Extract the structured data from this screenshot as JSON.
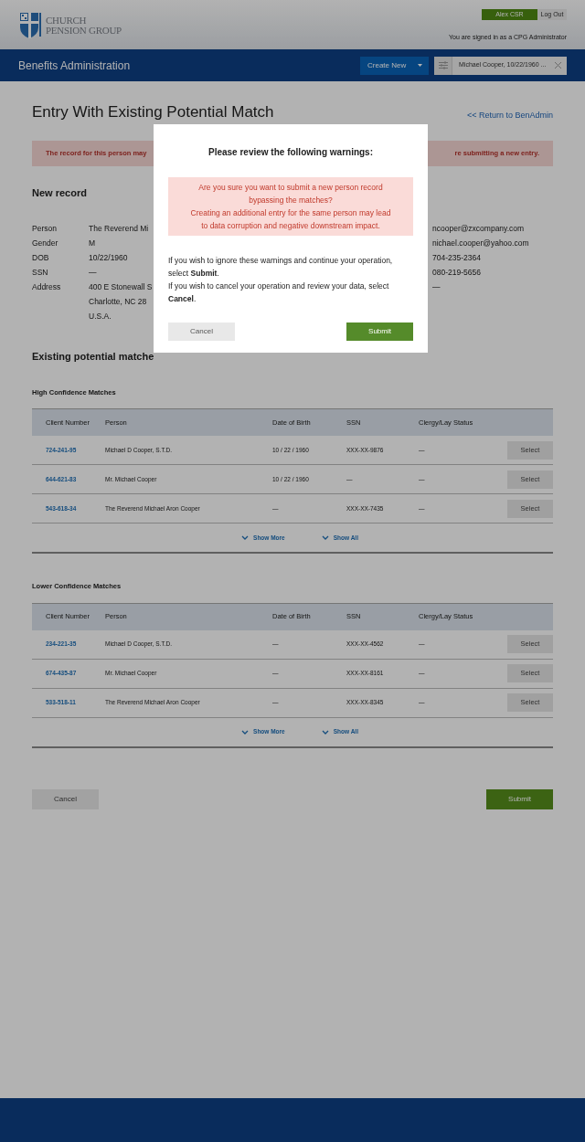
{
  "header": {
    "logo_lines": [
      "CHURCH",
      "PENSION GROUP"
    ],
    "user_button": "Alex CSR",
    "logout_button": "Log Out",
    "signed_in": "You are signed in as a CPG Administrator"
  },
  "navbar": {
    "title": "Benefits Administration",
    "create_new": "Create New",
    "search_chip": "Michael Cooper, 10/22/1960 ..."
  },
  "page": {
    "title": "Entry With Existing Potential Match",
    "return_link": "<< Return to BenAdmin",
    "warning_banner": [
      "The record for this person may",
      "re submitting a new entry."
    ]
  },
  "new_record": {
    "heading": "New record",
    "fields": [
      {
        "label": "Person",
        "values": [
          "The Reverend Mi"
        ]
      },
      {
        "label": "Gender",
        "values": [
          "M"
        ]
      },
      {
        "label": "DOB",
        "values": [
          "10/22/1960"
        ]
      },
      {
        "label": "SSN",
        "values": [
          "—"
        ]
      },
      {
        "label": "Address",
        "values": [
          "400 E Stonewall S",
          "Charlotte, NC 28",
          "U.S.A."
        ]
      }
    ],
    "right_values": [
      "ncooper@zxcompany.com",
      "nichael.cooper@yahoo.com",
      "704-235-2364",
      "080-219-5656",
      "—"
    ]
  },
  "matches": {
    "heading": "Existing potential matche",
    "groups": [
      {
        "title": "High Confidence Matches",
        "columns": [
          "Client Number",
          "Person",
          "Date of Birth",
          "SSN",
          "Clergy/Lay Status"
        ],
        "rows": [
          {
            "client_number": "724-241-95",
            "person": "Michael D Cooper, S.T.D.",
            "dob": "10 / 22 / 1960",
            "ssn": "XXX-XX-9876",
            "status": "—",
            "action": "Select"
          },
          {
            "client_number": "644-621-83",
            "person": "Mr. Michael Cooper",
            "dob": "10 / 22 / 1960",
            "ssn": "—",
            "status": "—",
            "action": "Select"
          },
          {
            "client_number": "543-618-34",
            "person": "The Reverend Michael Aron Cooper",
            "dob": "—",
            "ssn": "XXX-XX-7435",
            "status": "—",
            "action": "Select"
          }
        ],
        "show_more": "Show More",
        "show_all": "Show All"
      },
      {
        "title": "Lower Confidence Matches",
        "columns": [
          "Client Number",
          "Person",
          "Date of Birth",
          "SSN",
          "Clergy/Lay Status"
        ],
        "rows": [
          {
            "client_number": "234-221-35",
            "person": "Michael D Cooper, S.T.D.",
            "dob": "—",
            "ssn": "XXX-XX-4562",
            "status": "—",
            "action": "Select"
          },
          {
            "client_number": "674-435-87",
            "person": "Mr. Michael Cooper",
            "dob": "—",
            "ssn": "XXX-XX-8161",
            "status": "—",
            "action": "Select"
          },
          {
            "client_number": "533-518-11",
            "person": "The Reverend Michael Aron Cooper",
            "dob": "—",
            "ssn": "XXX-XX-8345",
            "status": "—",
            "action": "Select"
          }
        ],
        "show_more": "Show More",
        "show_all": "Show All"
      }
    ]
  },
  "footer_buttons": {
    "cancel": "Cancel",
    "submit": "Submit"
  },
  "modal": {
    "title": "Please review the following warnings:",
    "warning": [
      "Are you sure you want to submit a new person record bypassing the matches?",
      "Creating an additional entry for the same person may lead to data corruption and negative downstream impact."
    ],
    "instructions": [
      "If you wish to ignore these warnings and continue your operation, select **Submit**.",
      "If you wish to cancel your operation and review your data, select **Cancel**."
    ],
    "cancel": "Cancel",
    "submit": "Submit"
  }
}
